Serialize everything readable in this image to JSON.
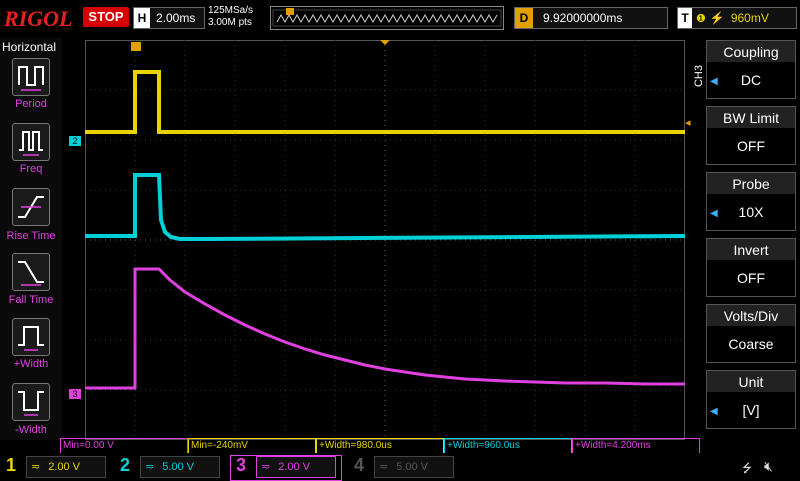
{
  "header": {
    "brand": "RIGOL",
    "run_state": "STOP",
    "timebase_label": "H",
    "timebase_value": "2.00ms",
    "sample_rate": "125MSa/s",
    "memory_depth": "3.00M pts",
    "delay_label": "D",
    "delay_value": "9.92000000ms",
    "trigger_label": "T",
    "trigger_level": "960mV"
  },
  "left_panel": {
    "title": "Horizontal",
    "items": [
      {
        "label": "Period"
      },
      {
        "label": "Freq"
      },
      {
        "label": "Rise Time"
      },
      {
        "label": "Fall Time"
      },
      {
        "label": "+Width"
      },
      {
        "label": "-Width"
      }
    ]
  },
  "right_menu": {
    "channel_tag": "CH3",
    "items": [
      {
        "title": "Coupling",
        "value": "DC"
      },
      {
        "title": "BW Limit",
        "value": "OFF"
      },
      {
        "title": "Probe",
        "value": "10X"
      },
      {
        "title": "Invert",
        "value": "OFF"
      },
      {
        "title": "Volts/Div",
        "value": "Coarse"
      },
      {
        "title": "Unit",
        "value": "[V]"
      }
    ]
  },
  "measurements": [
    {
      "text": "Min=0.00 V",
      "color": "#e040e0"
    },
    {
      "text": "Min=-240mV",
      "color": "#e8d400"
    },
    {
      "text": "+Width=980.0us",
      "color": "#e8d400"
    },
    {
      "text": "+Width=960.0us",
      "color": "#00d0d8"
    },
    {
      "text": "+Width=4.200ms",
      "color": "#e040e0"
    }
  ],
  "channels": [
    {
      "number": "1",
      "scale": "2.00 V",
      "color": "#e8d400",
      "active": true
    },
    {
      "number": "2",
      "scale": "5.00 V",
      "color": "#00d0d8",
      "active": true
    },
    {
      "number": "3",
      "scale": "2.00 V",
      "color": "#e040e0",
      "active": true
    },
    {
      "number": "4",
      "scale": "5.00 V",
      "color": "#555555",
      "active": false
    }
  ],
  "markers": {
    "ch2": "2",
    "ch3": "3",
    "trigger": "T"
  },
  "colors": {
    "ch1": "#e8d400",
    "ch2": "#00d0d8",
    "ch3": "#e040e0",
    "stop": "#d60000",
    "accent": "#3cb0ff"
  }
}
